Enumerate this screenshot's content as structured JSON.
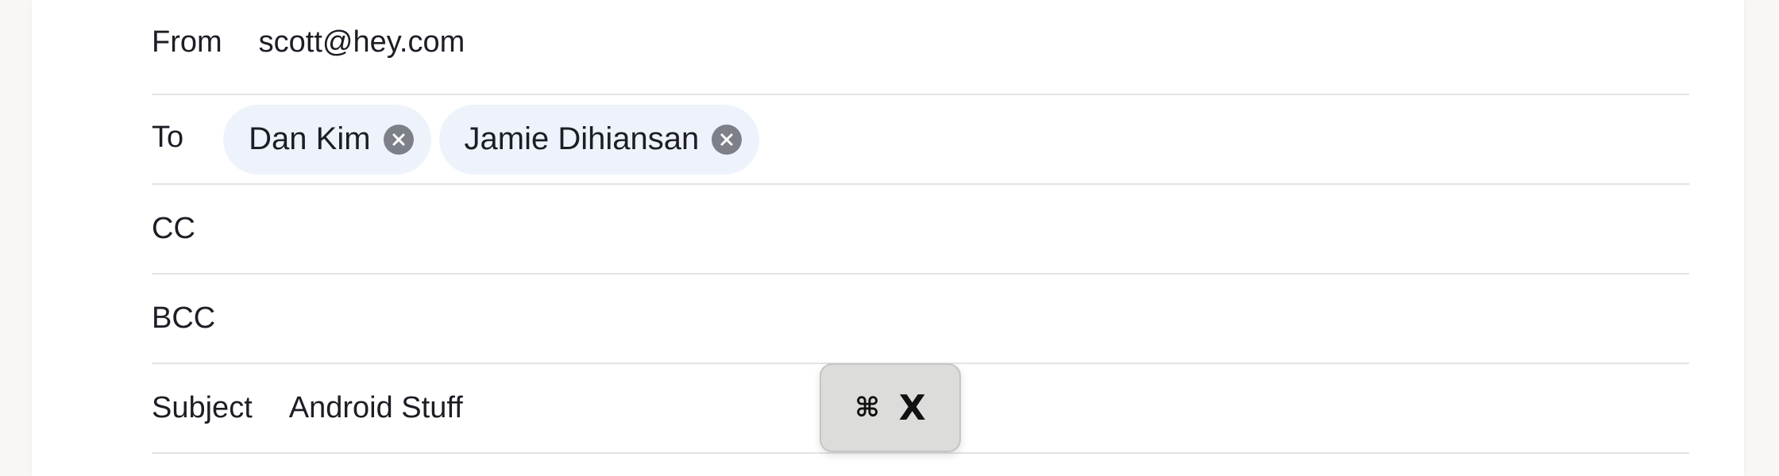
{
  "compose": {
    "from": {
      "label": "From",
      "value": "scott@hey.com"
    },
    "to": {
      "label": "To",
      "recipients": [
        {
          "name": "Dan Kim"
        },
        {
          "name": "Jamie Dihiansan"
        }
      ]
    },
    "cc": {
      "label": "CC",
      "value": ""
    },
    "bcc": {
      "label": "BCC",
      "value": ""
    },
    "subject": {
      "label": "Subject",
      "value": "Android Stuff"
    }
  },
  "shortcut_overlay": {
    "modifier": "⌘",
    "key": "X"
  },
  "icons": {
    "chip_remove": "close-circle-icon"
  },
  "colors": {
    "chip_background": "#eef3fb",
    "chip_remove": "#7d8088",
    "divider": "#e3e3e6",
    "overlay_background": "#dcdcda"
  }
}
